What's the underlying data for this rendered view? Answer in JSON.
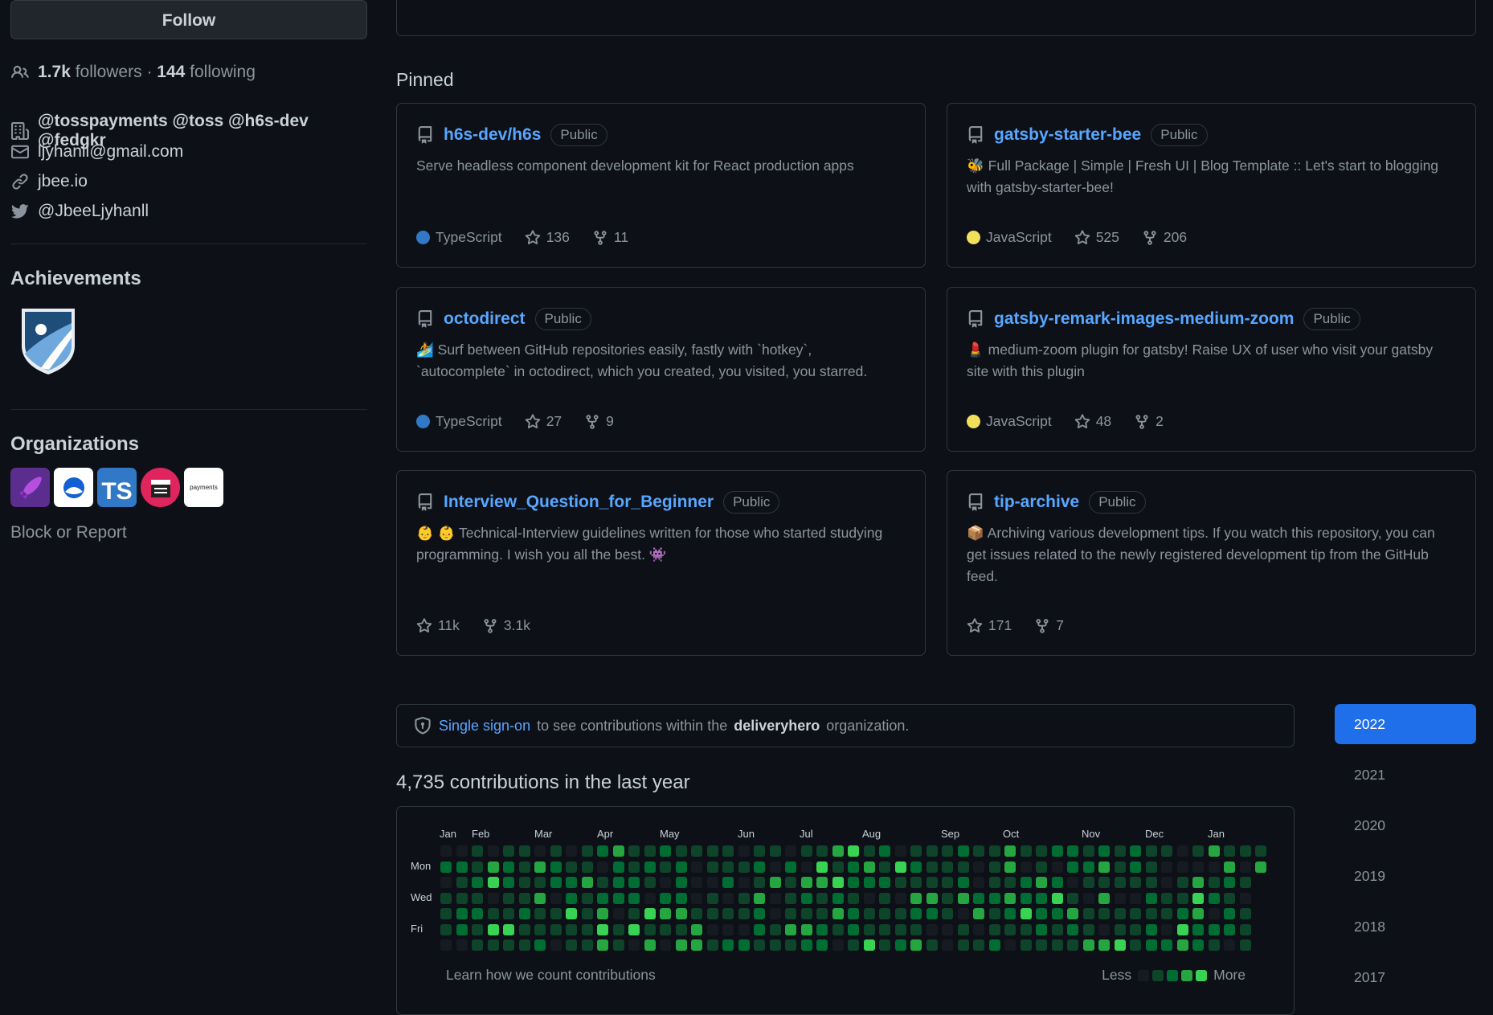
{
  "sidebar": {
    "follow_label": "Follow",
    "followers_count": "1.7k",
    "followers_label": "followers",
    "separator": "·",
    "following_count": "144",
    "following_label": "following",
    "orgs_text": "@tosspayments @toss @h6s-dev @fedgkr",
    "email": "ljyhanll@gmail.com",
    "website": "jbee.io",
    "twitter": "@JbeeLjyhanll",
    "achievements_title": "Achievements",
    "organizations_title": "Organizations",
    "organizations": [
      {
        "name": "rocket-org",
        "text": "",
        "bg": "#5b2d8e"
      },
      {
        "name": "toss-org",
        "text": "",
        "bg": "#ffffff"
      },
      {
        "name": "ts-org",
        "text": "TS",
        "bg": "#3178c6"
      },
      {
        "name": "film-org",
        "text": "",
        "bg": "#e0245e"
      },
      {
        "name": "payments-org",
        "text": "payments",
        "bg": "#ffffff"
      }
    ],
    "block_report": "Block or Report"
  },
  "pinned": {
    "title": "Pinned",
    "repos": [
      {
        "name": "h6s-dev/h6s",
        "visibility": "Public",
        "description": "Serve headless component development kit for React production apps",
        "language": "TypeScript",
        "lang_color": "#3178c6",
        "stars": "136",
        "forks": "11"
      },
      {
        "name": "gatsby-starter-bee",
        "visibility": "Public",
        "description": "🐝 Full Package | Simple | Fresh UI | Blog Template :: Let's start to blogging with gatsby-starter-bee!",
        "language": "JavaScript",
        "lang_color": "#f1e05a",
        "stars": "525",
        "forks": "206"
      },
      {
        "name": "octodirect",
        "visibility": "Public",
        "description": "🏄 Surf between GitHub repositories easily, fastly with `hotkey`, `autocomplete` in octodirect, which you created, you visited, you starred.",
        "language": "TypeScript",
        "lang_color": "#3178c6",
        "stars": "27",
        "forks": "9"
      },
      {
        "name": "gatsby-remark-images-medium-zoom",
        "visibility": "Public",
        "description": "💄 medium-zoom plugin for gatsby! Raise UX of user who visit your gatsby site with this plugin",
        "language": "JavaScript",
        "lang_color": "#f1e05a",
        "stars": "48",
        "forks": "2"
      },
      {
        "name": "Interview_Question_for_Beginner",
        "visibility": "Public",
        "description": "👶 👶 Technical-Interview guidelines written for those who started studying programming. I wish you all the best. 👾",
        "language": "",
        "lang_color": "",
        "stars": "11k",
        "forks": "3.1k"
      },
      {
        "name": "tip-archive",
        "visibility": "Public",
        "description": "📦 Archiving various development tips. If you watch this repository, you can get issues related to the newly registered development tip from the GitHub feed.",
        "language": "",
        "lang_color": "",
        "stars": "171",
        "forks": "7"
      }
    ]
  },
  "sso": {
    "link": "Single sign-on",
    "text_before": "to see contributions within the",
    "org": "deliveryhero",
    "text_after": "organization."
  },
  "contributions": {
    "title": "4,735 contributions in the last year",
    "months": [
      "Jan",
      "Feb",
      "Mar",
      "Apr",
      "May",
      "Jun",
      "Jul",
      "Aug",
      "Sep",
      "Oct",
      "Nov",
      "Dec",
      "Jan"
    ],
    "days": [
      "Mon",
      "Wed",
      "Fri"
    ],
    "learn": "Learn how we count contributions",
    "less": "Less",
    "more": "More",
    "level_colors": [
      "#161b22",
      "#0e4429",
      "#006d32",
      "#26a641",
      "#39d353"
    ]
  },
  "years": [
    "2022",
    "2021",
    "2020",
    "2019",
    "2018",
    "2017"
  ]
}
